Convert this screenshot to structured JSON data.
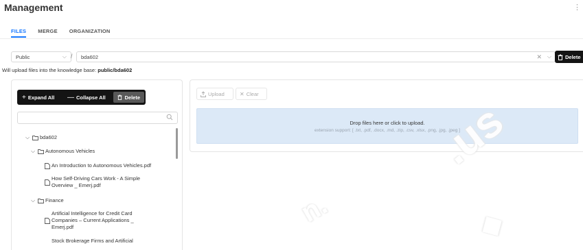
{
  "page": {
    "title": "Management"
  },
  "tabs": [
    {
      "label": "FILES",
      "active": true
    },
    {
      "label": "MERGE",
      "active": false
    },
    {
      "label": "ORGANIZATION",
      "active": false
    }
  ],
  "scope": {
    "selected": "Public",
    "separator": "/",
    "path_value": "bda602",
    "delete_label": "Delete"
  },
  "hint": {
    "prefix": "Will upload files into the knowledge base:",
    "target": "public/bda602"
  },
  "tree_toolbar": {
    "expand_label": "Expand All",
    "collapse_label": "Collapse All",
    "delete_label": "Delete"
  },
  "tree_search": {
    "placeholder": ""
  },
  "tree": {
    "root": "bda602",
    "folder1": "Autonomous Vehicles",
    "file1": "An Introduction to Autonomous Vehicles.pdf",
    "file2_l1": "How Self-Driving Cars Work - A Simple",
    "file2_l2": "Overview _ Emerj.pdf",
    "folder2": "Finance",
    "file3_l1": "Artificial Intelligence for Credit Card",
    "file3_l2": "Companies – Current Applications _",
    "file3_l3": "Emerj.pdf",
    "file4_l1": "Stock Brokerage Firms and Artificial"
  },
  "upload": {
    "upload_label": "Upload",
    "clear_label": "Clear",
    "drop_text": "Drop files here or click to upload.",
    "extensions_text": "extension support: [ .txt, .pdf, .docx, .md, .zip, .csv, .xlsx, .png, .jpg, .jpeg ]"
  },
  "colors": {
    "accent": "#1677ff",
    "dark_button": "#141414",
    "dropzone_bg": "#dce9f7"
  }
}
